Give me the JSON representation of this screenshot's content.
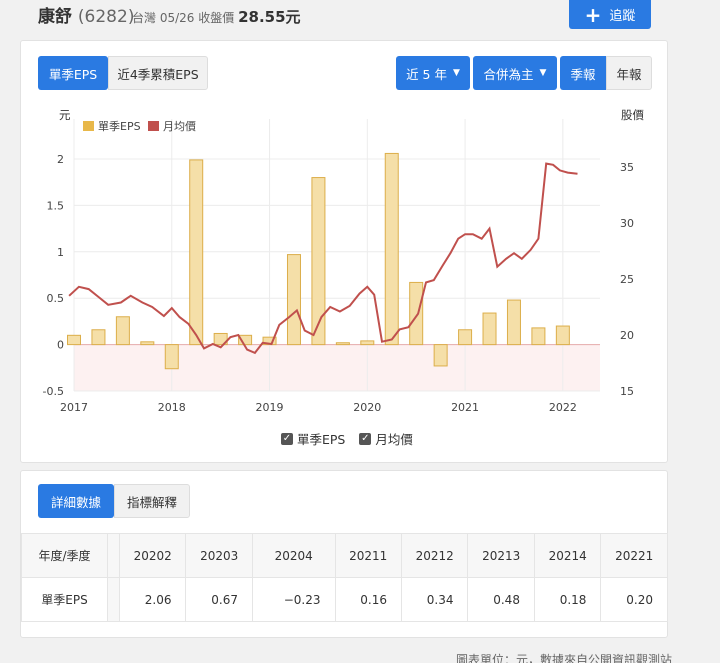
{
  "header": {
    "name": "康舒",
    "code": "(6282)",
    "market": "台灣",
    "date": "05/26",
    "price_label": "收盤價",
    "price": "28.55元",
    "follow_label": "追蹤"
  },
  "tabs": {
    "quarter_eps": "單季EPS",
    "rolling_eps": "近4季累積EPS"
  },
  "filters": {
    "range": "近 5 年",
    "basis": "合併為主",
    "quarterly": "季報",
    "annual": "年報"
  },
  "colors": {
    "accent": "#2a7ae2",
    "bar_fill": "#f5dfa8",
    "bar_stroke": "#dcae4a",
    "line": "#c0504d",
    "negative_band": "#fdf1f1"
  },
  "chart_data": {
    "type": "bar+line",
    "y_left_label": "元",
    "y_right_label": "股價",
    "ylim_left": [
      -0.5,
      2.5
    ],
    "ylim_right": [
      15,
      40
    ],
    "left_ticks": [
      "-0.5",
      "0",
      "0.5",
      "1",
      "1.5",
      "2"
    ],
    "right_ticks": [
      "15",
      "20",
      "25",
      "30",
      "35"
    ],
    "x_ticks": [
      "2017",
      "2018",
      "2019",
      "2020",
      "2021",
      "2022"
    ],
    "legend": [
      "單季EPS",
      "月均價"
    ],
    "eps_series": {
      "name": "單季EPS",
      "x": [
        2017.0,
        2017.25,
        2017.5,
        2017.75,
        2018.0,
        2018.25,
        2018.5,
        2018.75,
        2019.0,
        2019.25,
        2019.5,
        2019.75,
        2020.0,
        2020.25,
        2020.5,
        2020.75,
        2021.0,
        2021.25,
        2021.5,
        2021.75,
        2022.0
      ],
      "values": [
        0.1,
        0.16,
        0.3,
        0.03,
        -0.26,
        1.99,
        0.12,
        0.1,
        0.08,
        0.97,
        1.8,
        0.02,
        0.04,
        2.06,
        0.67,
        -0.23,
        0.16,
        0.34,
        0.48,
        0.18,
        0.2
      ]
    },
    "price_series": {
      "name": "月均價",
      "x": [
        2016.95,
        2017.05,
        2017.15,
        2017.25,
        2017.35,
        2017.48,
        2017.58,
        2017.7,
        2017.8,
        2017.92,
        2018.0,
        2018.08,
        2018.17,
        2018.25,
        2018.33,
        2018.42,
        2018.5,
        2018.6,
        2018.68,
        2018.77,
        2018.85,
        2018.93,
        2019.02,
        2019.1,
        2019.2,
        2019.28,
        2019.36,
        2019.45,
        2019.53,
        2019.62,
        2019.72,
        2019.82,
        2019.92,
        2020.0,
        2020.07,
        2020.15,
        2020.25,
        2020.33,
        2020.42,
        2020.52,
        2020.6,
        2020.68,
        2020.77,
        2020.85,
        2020.93,
        2021.0,
        2021.08,
        2021.17,
        2021.25,
        2021.33,
        2021.42,
        2021.5,
        2021.58,
        2021.67,
        2021.75,
        2021.83,
        2021.9,
        2021.97,
        2022.05,
        2022.15
      ],
      "values": [
        23.5,
        24.3,
        24.1,
        23.4,
        22.7,
        22.9,
        23.5,
        22.9,
        22.5,
        21.7,
        22.4,
        21.6,
        21.0,
        20.0,
        18.8,
        19.2,
        18.9,
        19.8,
        20.0,
        18.7,
        18.4,
        19.3,
        19.2,
        20.9,
        21.6,
        22.2,
        20.4,
        20.0,
        21.6,
        22.5,
        22.1,
        22.6,
        23.7,
        24.3,
        23.6,
        19.4,
        19.6,
        20.5,
        20.7,
        21.9,
        24.7,
        24.9,
        26.2,
        27.3,
        28.6,
        29.0,
        29.0,
        28.6,
        29.5,
        26.1,
        26.8,
        27.3,
        26.8,
        27.6,
        28.6,
        35.3,
        35.2,
        34.7,
        34.5,
        34.4
      ]
    }
  },
  "detail": {
    "tab_detail": "詳細數據",
    "tab_explain": "指標解釋",
    "header_label": "年度/季度",
    "row_label": "單季EPS",
    "periods": [
      "20202",
      "20203",
      "20204",
      "20211",
      "20212",
      "20213",
      "20214",
      "20221"
    ],
    "values": [
      "2.06",
      "0.67",
      "−0.23",
      "0.16",
      "0.34",
      "0.48",
      "0.18",
      "0.20"
    ]
  },
  "footnote": "圖表單位：元，數據來自公開資訊觀測站"
}
